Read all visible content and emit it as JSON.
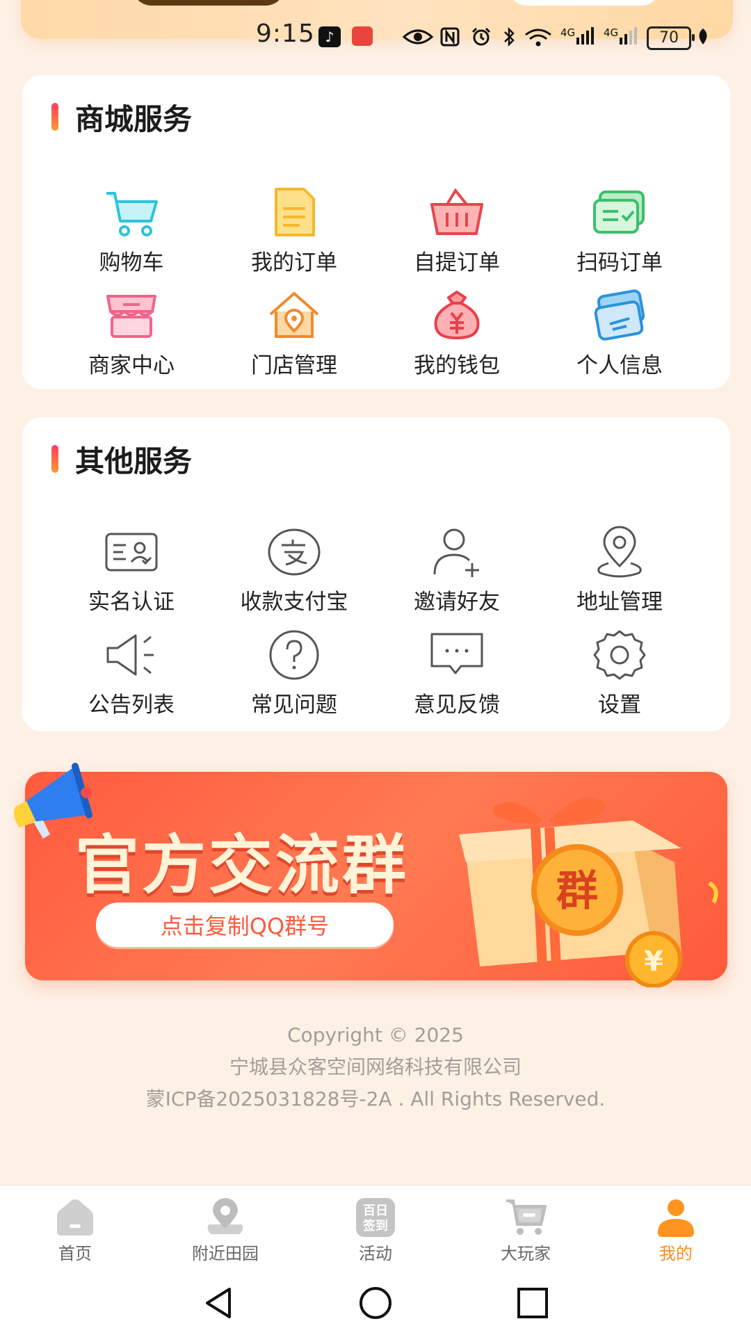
{
  "status_bar": {
    "time": "9:15",
    "network_a": "4G",
    "network_b": "4G",
    "battery": "70"
  },
  "mall_services": {
    "title": "商城服务",
    "items": [
      {
        "label": "购物车",
        "icon": "shopping-cart-icon"
      },
      {
        "label": "我的订单",
        "icon": "order-document-icon"
      },
      {
        "label": "自提订单",
        "icon": "basket-icon"
      },
      {
        "label": "扫码订单",
        "icon": "scan-order-icon"
      },
      {
        "label": "商家中心",
        "icon": "shop-awning-icon"
      },
      {
        "label": "门店管理",
        "icon": "store-house-icon"
      },
      {
        "label": "我的钱包",
        "icon": "money-bag-icon"
      },
      {
        "label": "个人信息",
        "icon": "id-card-icon"
      }
    ]
  },
  "other_services": {
    "title": "其他服务",
    "items": [
      {
        "label": "实名认证",
        "icon": "identity-card-icon"
      },
      {
        "label": "收款支付宝",
        "icon": "alipay-icon"
      },
      {
        "label": "邀请好友",
        "icon": "add-user-icon"
      },
      {
        "label": "地址管理",
        "icon": "location-pin-icon"
      },
      {
        "label": "公告列表",
        "icon": "megaphone-icon"
      },
      {
        "label": "常见问题",
        "icon": "question-icon"
      },
      {
        "label": "意见反馈",
        "icon": "chat-bubble-icon"
      },
      {
        "label": "设置",
        "icon": "gear-icon"
      }
    ]
  },
  "promo": {
    "title": "官方交流群",
    "button_label": "点击复制QQ群号",
    "badge": "群",
    "coin_symbol": "¥"
  },
  "footer": {
    "copyright": "Copyright © 2025",
    "company": "宁城县众客空间网络科技有限公司",
    "icp": "蒙ICP备2025031828号-2A . All Rights Reserved."
  },
  "tabbar": {
    "tabs": [
      {
        "label": "首页",
        "icon": "home-icon",
        "active": false
      },
      {
        "label": "附近田园",
        "icon": "location-icon",
        "active": false
      },
      {
        "label": "活动",
        "icon": "checkin-icon",
        "badge_text_1": "百日",
        "badge_text_2": "签到",
        "active": false
      },
      {
        "label": "大玩家",
        "icon": "cart-icon",
        "active": false
      },
      {
        "label": "我的",
        "icon": "user-icon",
        "active": true
      }
    ]
  },
  "colors": {
    "accent": "#ff8c1a",
    "page_bg": "#fdf1e6",
    "promo_red": "#ff5b3e"
  }
}
